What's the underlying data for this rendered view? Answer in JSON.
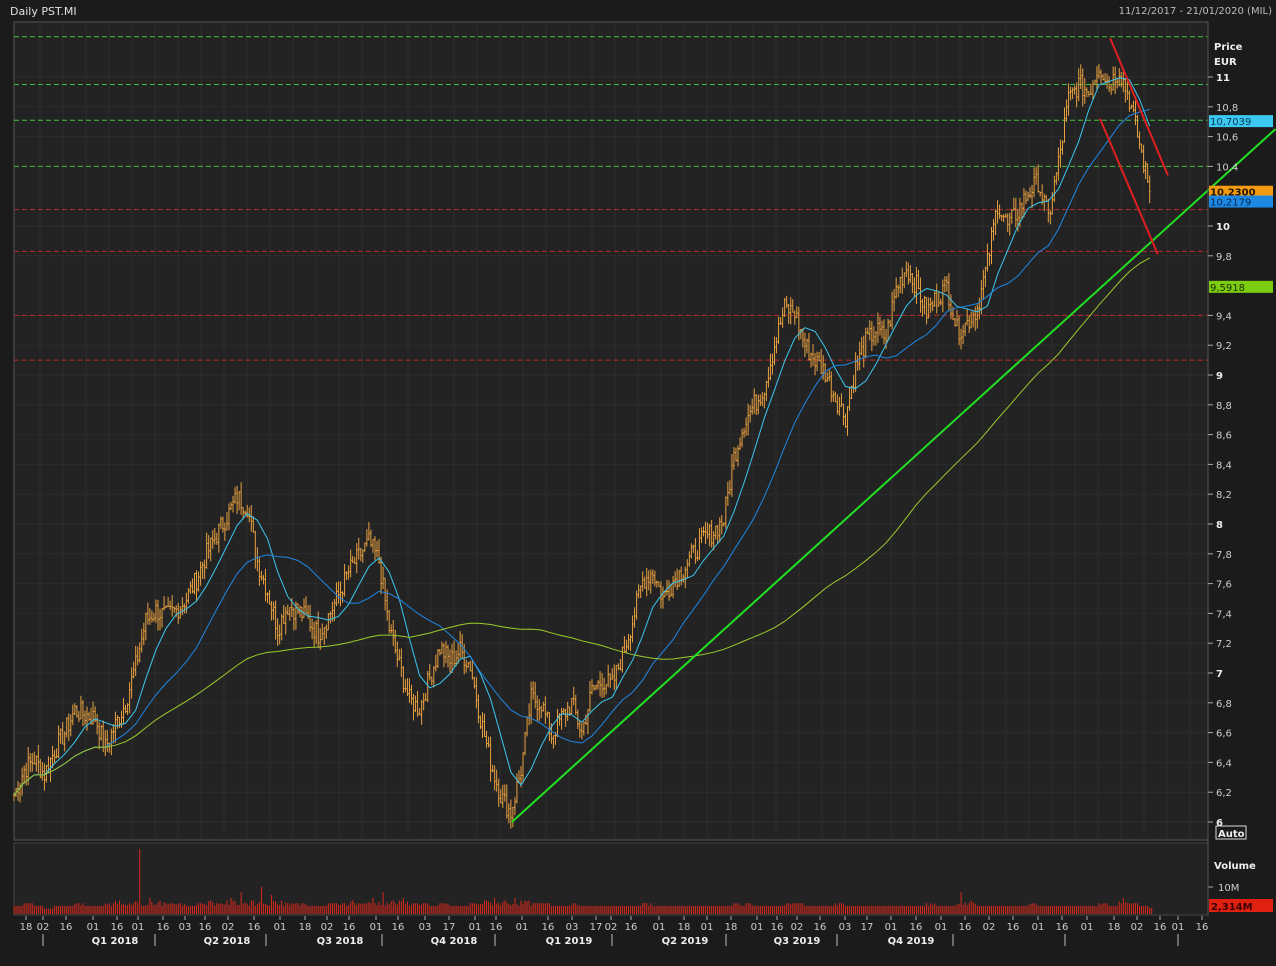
{
  "header": {
    "title": "Daily PST.MI",
    "range": "11/12/2017 - 21/01/2020 (MIL)"
  },
  "chart_data": {
    "type": "ohlc",
    "title": "Daily PST.MI",
    "ylabel": "Price",
    "yunit": "EUR",
    "ylim": [
      6,
      11.27
    ],
    "yticks": [
      "11",
      "10,8",
      "10,6",
      "10,4",
      "10",
      "9,8",
      "9,4",
      "9,2",
      "9",
      "8,8",
      "8,6",
      "8,4",
      "8,2",
      "8",
      "7,8",
      "7,6",
      "7,4",
      "7,2",
      "7",
      "6,8",
      "6,6",
      "6,4",
      "6,2",
      "6"
    ],
    "ytick_values": [
      11,
      10.8,
      10.6,
      10.4,
      10,
      9.8,
      9.4,
      9.2,
      9,
      8.8,
      8.6,
      8.4,
      8.2,
      8,
      7.8,
      7.6,
      7.4,
      7.2,
      7,
      6.8,
      6.6,
      6.4,
      6.2,
      6
    ],
    "bold_ticks": [
      11,
      10,
      9,
      8,
      7,
      6
    ],
    "scale_mode": "Auto",
    "x_interval": "week",
    "x_start": "11/12/2017",
    "weekly_close": [
      6.18,
      6.35,
      6.42,
      6.32,
      6.48,
      6.6,
      6.75,
      6.72,
      6.7,
      6.5,
      6.65,
      6.8,
      7.05,
      7.35,
      7.42,
      7.38,
      7.42,
      7.5,
      7.63,
      7.8,
      7.93,
      8.05,
      8.18,
      8.12,
      7.75,
      7.55,
      7.3,
      7.45,
      7.42,
      7.36,
      7.26,
      7.38,
      7.52,
      7.68,
      7.78,
      7.88,
      7.75,
      7.3,
      7.05,
      6.82,
      6.76,
      6.97,
      7.17,
      7.08,
      7.15,
      7.05,
      6.7,
      6.4,
      6.18,
      6.06,
      6.35,
      6.83,
      6.8,
      6.58,
      6.7,
      6.8,
      6.6,
      6.88,
      6.95,
      6.92,
      7.12,
      7.35,
      7.62,
      7.68,
      7.5,
      7.62,
      7.7,
      7.8,
      7.9,
      7.95,
      8.03,
      8.45,
      8.68,
      8.8,
      8.92,
      9.2,
      9.45,
      9.42,
      9.2,
      9.1,
      9.02,
      8.85,
      8.72,
      9.05,
      9.22,
      9.3,
      9.25,
      9.58,
      9.72,
      9.6,
      9.42,
      9.52,
      9.6,
      9.3,
      9.35,
      9.45,
      9.75,
      10.15,
      10.0,
      10.1,
      10.22,
      10.3,
      10.05,
      10.42,
      10.85,
      10.95,
      10.9,
      11.08,
      10.95,
      11.05,
      10.85,
      10.55,
      10.23
    ],
    "weekly_volume_m": [
      3,
      4,
      3,
      2,
      3,
      3,
      4,
      3,
      3,
      4,
      5,
      4,
      24,
      6,
      5,
      4,
      4,
      3,
      4,
      5,
      4,
      6,
      8,
      5,
      10,
      7,
      5,
      4,
      4,
      3,
      3,
      4,
      4,
      5,
      4,
      6,
      8,
      5,
      6,
      4,
      4,
      3,
      4,
      3,
      3,
      4,
      5,
      6,
      5,
      6,
      5,
      4,
      4,
      3,
      3,
      4,
      3,
      3,
      3,
      3,
      3,
      3,
      4,
      3,
      3,
      3,
      3,
      3,
      3,
      3,
      3,
      4,
      4,
      3,
      3,
      3,
      4,
      4,
      3,
      3,
      3,
      4,
      3,
      3,
      3,
      3,
      3,
      3,
      3,
      3,
      4,
      3,
      3,
      8,
      5,
      3,
      3,
      3,
      3,
      3,
      4,
      3,
      3,
      3,
      3,
      3,
      3,
      4,
      3,
      6,
      4,
      3,
      2.3
    ],
    "series": [
      {
        "name": "Price (OHLC)",
        "color": "#e8a040",
        "last_label": "10,2300"
      },
      {
        "name": "MA short",
        "color": "#3cc8f0",
        "period_weeks": 4,
        "last_label": "10,7039"
      },
      {
        "name": "MA medium",
        "color": "#1e88e5",
        "period_weeks": 10,
        "last_label": "10,2179"
      },
      {
        "name": "MA long",
        "color": "#9ccc2c",
        "period_weeks": 40,
        "last_label": "9,5918"
      }
    ],
    "resistance_levels": [
      11.27,
      10.95,
      10.71,
      10.4
    ],
    "support_levels": [
      10.11,
      9.83,
      9.4,
      9.1
    ],
    "trendlines": [
      {
        "name": "uptrend",
        "color": "#22e022",
        "points": [
          [
            49.1,
            6.0
          ],
          [
            124.4,
            10.65
          ]
        ]
      },
      {
        "name": "channel-upper",
        "color": "#e02020",
        "points": [
          [
            108.1,
            11.26
          ],
          [
            113.8,
            10.34
          ]
        ]
      },
      {
        "name": "channel-lower",
        "color": "#e02020",
        "points": [
          [
            107.1,
            10.72
          ],
          [
            112.8,
            9.81
          ]
        ]
      }
    ],
    "volume": {
      "label": "Volume",
      "tick": "10M",
      "last_label": "2,314M"
    },
    "x_ticks": [
      "18",
      "02",
      "16",
      "01",
      "16",
      "01",
      "16",
      "03",
      "16",
      "02",
      "16",
      "01",
      "18",
      "02",
      "16",
      "01",
      "16",
      "03",
      "17",
      "01",
      "16",
      "01",
      "16",
      "03",
      "17",
      "02",
      "16",
      "01",
      "18",
      "01",
      "18",
      "01",
      "16",
      "02",
      "16",
      "03",
      "17",
      "01",
      "16",
      "01",
      "16",
      "02",
      "16",
      "01",
      "16",
      "01",
      "18",
      "02",
      "16",
      "01",
      "16"
    ],
    "quarters": [
      "Q1 2018",
      "Q2 2018",
      "Q3 2018",
      "Q4 2018",
      "Q1 2019",
      "Q2 2019",
      "Q3 2019",
      "Q4 2019"
    ]
  }
}
